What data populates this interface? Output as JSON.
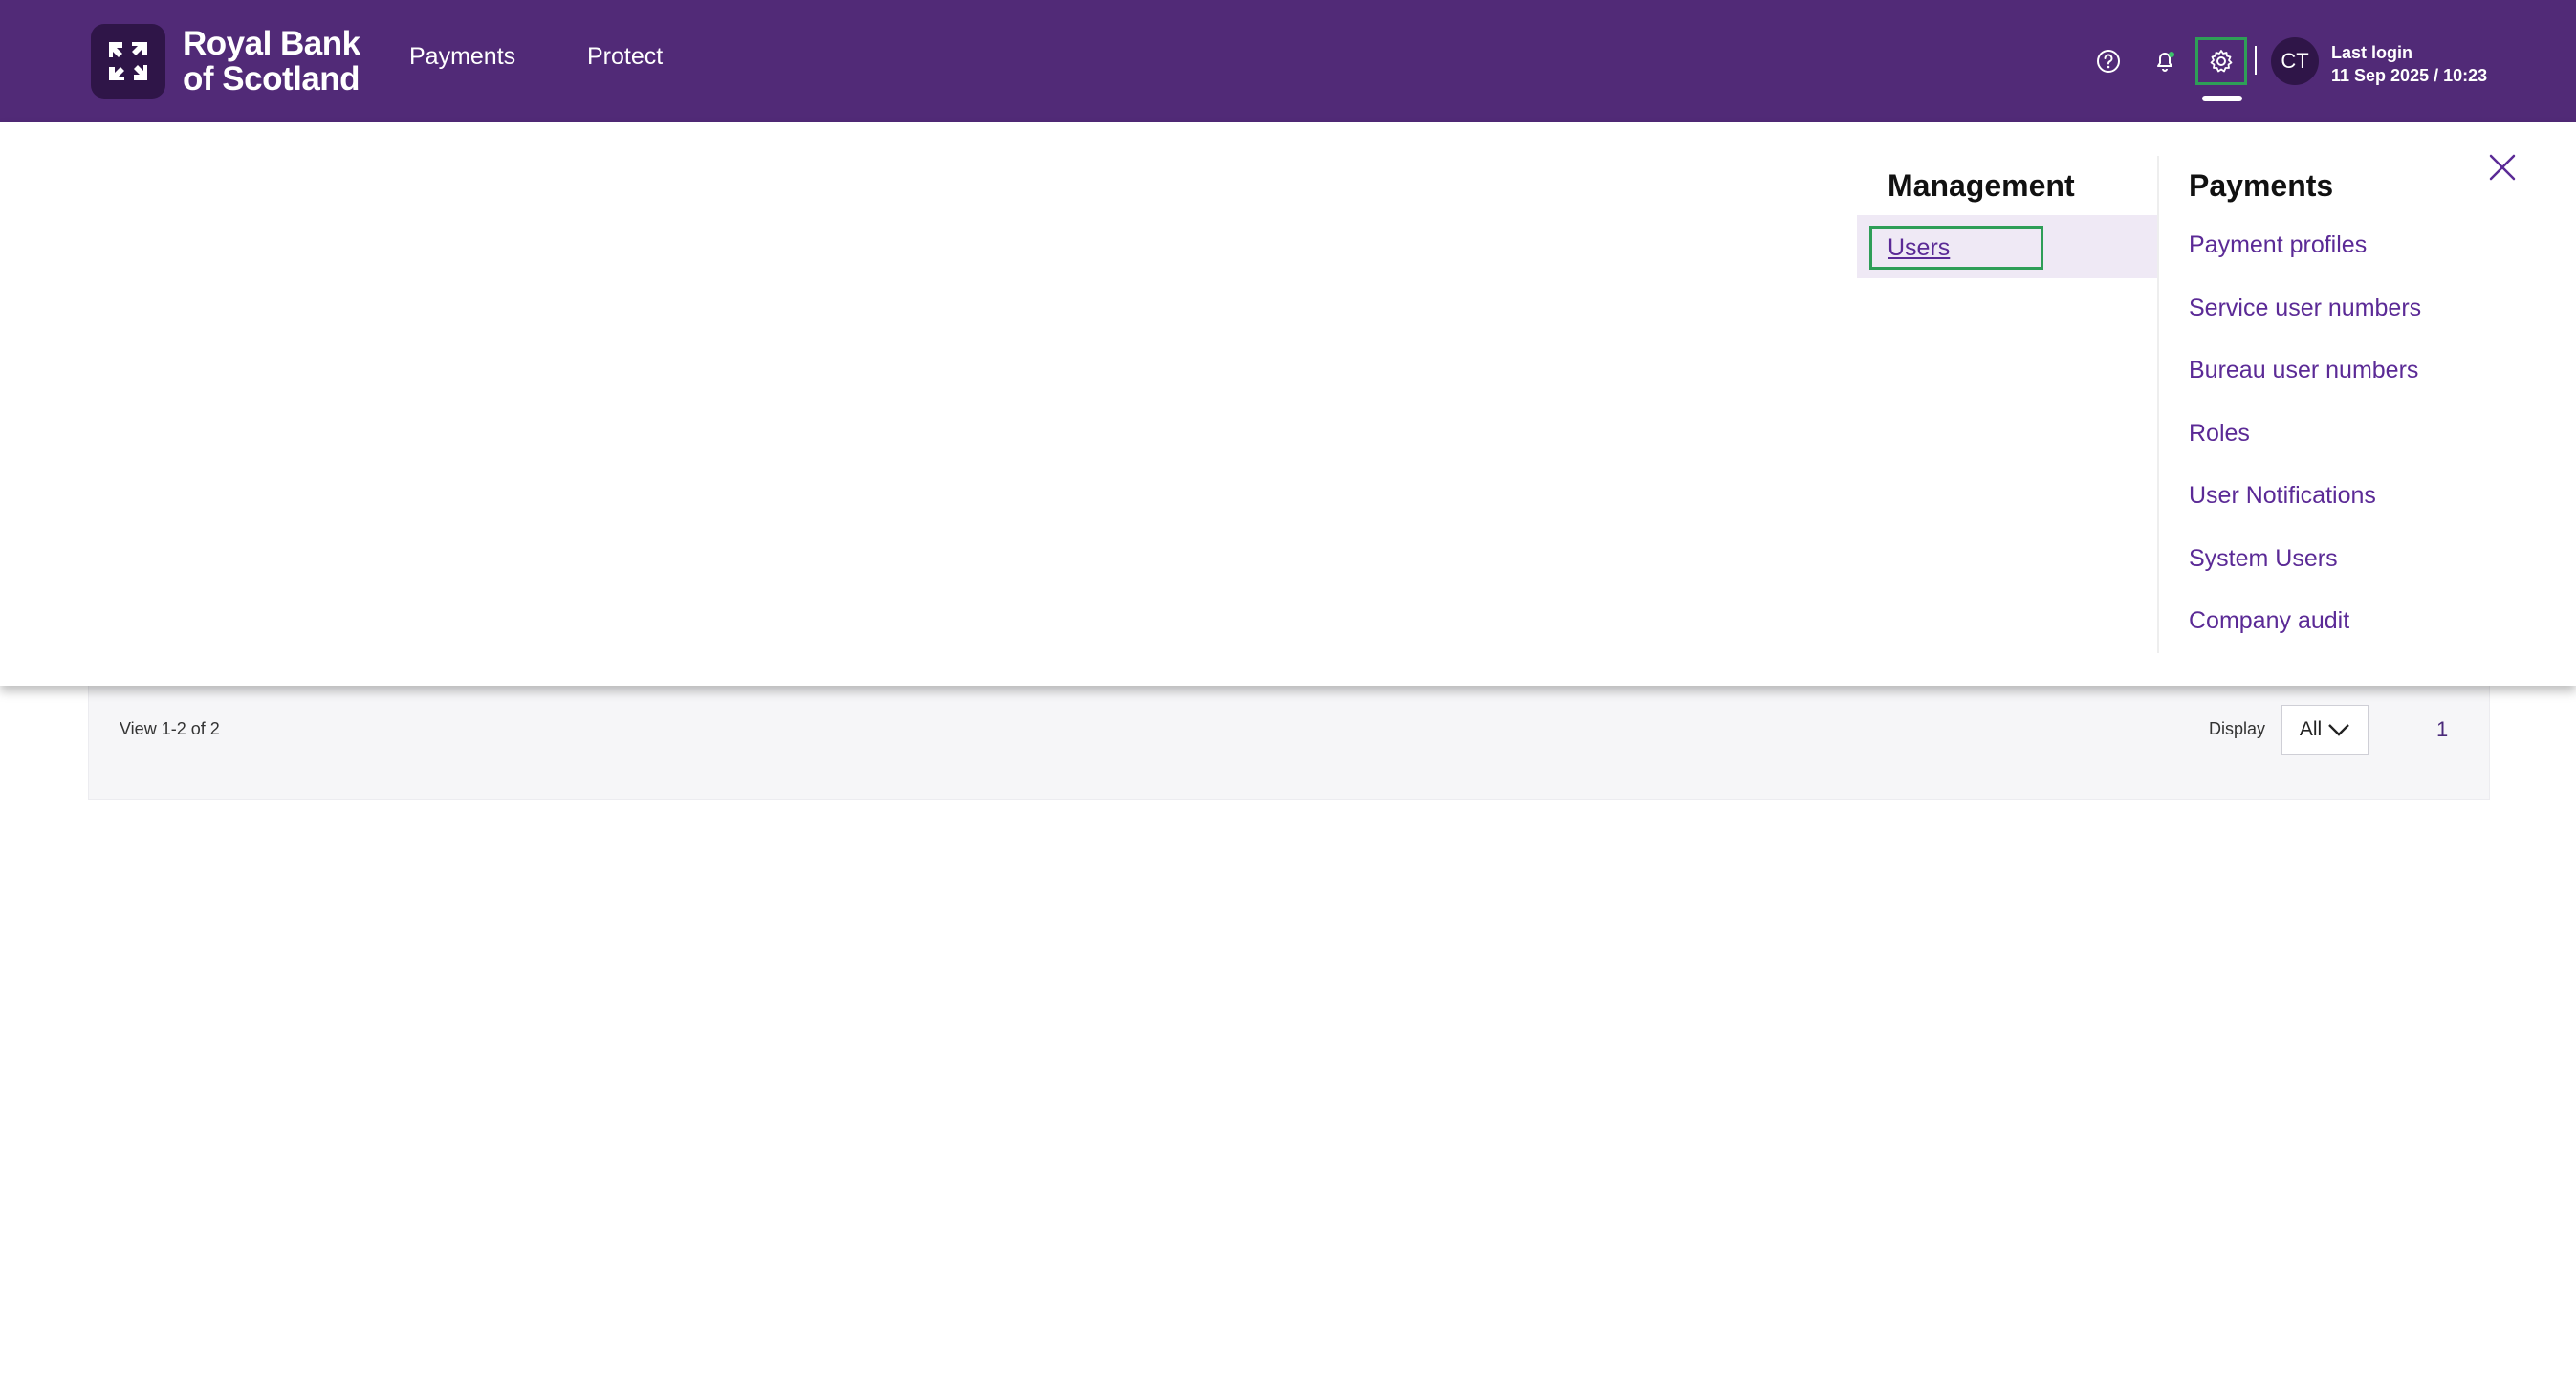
{
  "header": {
    "brand": "Royal Bank\nof Scotland",
    "nav": [
      {
        "label": "Payments"
      },
      {
        "label": "Protect"
      }
    ],
    "icons": {
      "help": "help-circle-icon",
      "notifications": "bell-icon",
      "settings": "gear-icon"
    },
    "avatar_initials": "CT",
    "last_login_label": "Last login",
    "last_login_value": "11 Sep 2025 / 10:23"
  },
  "mega_menu": {
    "management": {
      "title": "Management",
      "items": [
        {
          "label": "Users"
        }
      ]
    },
    "payments": {
      "title": "Payments",
      "items": [
        {
          "label": "Payment profiles"
        },
        {
          "label": "Service user numbers"
        },
        {
          "label": "Bureau user numbers"
        },
        {
          "label": "Roles"
        },
        {
          "label": "User Notifications"
        },
        {
          "label": "System Users"
        },
        {
          "label": "Company audit"
        }
      ]
    },
    "close_icon": "close-icon"
  },
  "table_footer": {
    "view_count": "View 1-2 of 2",
    "display_label": "Display",
    "display_value": "All",
    "page": "1"
  },
  "colors": {
    "header_bg": "#512a77",
    "link": "#5b2a96",
    "focus_outline": "#2e9e57"
  }
}
